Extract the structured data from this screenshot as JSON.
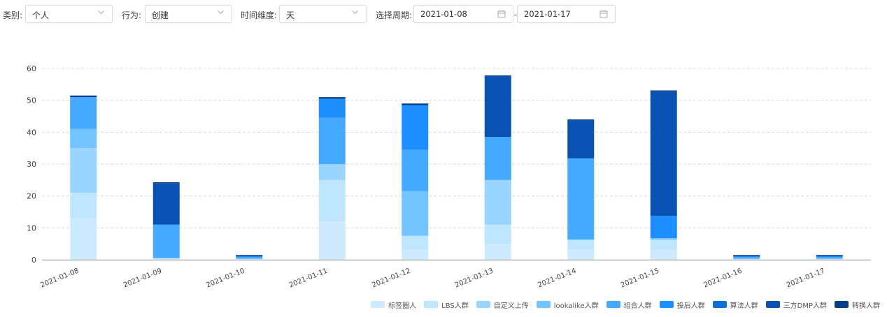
{
  "filters": {
    "category_label": "类别:",
    "category_value": "个人",
    "action_label": "行为:",
    "action_value": "创建",
    "time_dim_label": "时间维度:",
    "time_dim_value": "天",
    "period_label": "选择周期:",
    "start_date": "2021-01-08",
    "end_date": "2021-01-17",
    "range_sep": "~"
  },
  "chart_data": {
    "type": "bar",
    "stacked": true,
    "categories": [
      "2021-01-08",
      "2021-01-09",
      "2021-01-10",
      "2021-01-11",
      "2021-01-12",
      "2021-01-13",
      "2021-01-14",
      "2021-01-15",
      "2021-01-16",
      "2021-01-17"
    ],
    "ylim": [
      0,
      60
    ],
    "yticks": [
      0,
      10,
      20,
      30,
      40,
      50,
      60
    ],
    "grid": true,
    "legend_position": "bottom-right",
    "series": [
      {
        "name": "标签圈人",
        "color": "#cdeaff",
        "values": [
          13,
          0.5,
          0.3,
          12,
          3,
          5,
          3,
          3,
          0.3,
          0.3
        ]
      },
      {
        "name": "LBS人群",
        "color": "#bfe6ff",
        "values": [
          8,
          0,
          0,
          13,
          4.5,
          6,
          3.3,
          3.3,
          0,
          0
        ]
      },
      {
        "name": "自定义上传",
        "color": "#99d5ff",
        "values": [
          14,
          0,
          0,
          5,
          0,
          14,
          0,
          0,
          0,
          0
        ]
      },
      {
        "name": "lookalike人群",
        "color": "#73c3ff",
        "values": [
          6,
          0,
          0,
          0,
          14,
          0,
          0,
          0.5,
          0,
          0
        ]
      },
      {
        "name": "组合人群",
        "color": "#45aaff",
        "values": [
          10,
          10.5,
          0.7,
          14.5,
          13,
          13.5,
          25.5,
          0,
          0.7,
          0.7
        ]
      },
      {
        "name": "投后人群",
        "color": "#1e8eff",
        "values": [
          0,
          0,
          0,
          6,
          14,
          0,
          0,
          7,
          0,
          0
        ]
      },
      {
        "name": "算法人群",
        "color": "#0e6fd6",
        "values": [
          0,
          0,
          0,
          0,
          0,
          0,
          0,
          0,
          0,
          0
        ]
      },
      {
        "name": "三方DMP人群",
        "color": "#0952b3",
        "values": [
          0,
          13,
          0.5,
          0,
          0,
          19,
          12,
          39,
          0.5,
          0.5
        ]
      },
      {
        "name": "转换人群",
        "color": "#083d8c",
        "values": [
          0.5,
          0.3,
          0,
          0.5,
          0.5,
          0.3,
          0.2,
          0.3,
          0,
          0
        ]
      }
    ]
  }
}
